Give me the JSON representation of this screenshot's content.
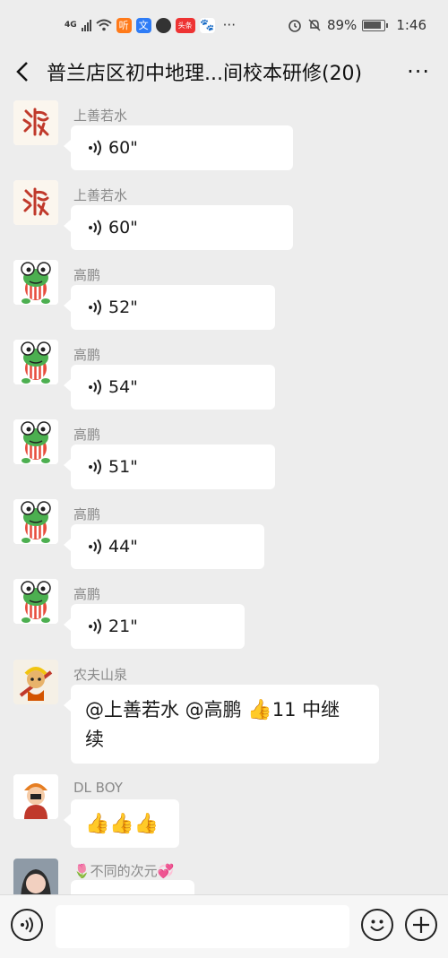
{
  "status_bar": {
    "network": "4G",
    "battery": "89%",
    "time": "1:46",
    "app_badges": [
      "听",
      "文",
      "头条"
    ],
    "overflow": "···"
  },
  "header": {
    "title": "普兰店区初中地理...间校本研修(20)",
    "more": "···"
  },
  "messages": [
    {
      "sender": "上善若水",
      "duration": "60\""
    },
    {
      "sender": "上善若水",
      "duration": "60\""
    },
    {
      "sender": "高鹏",
      "duration": "52\""
    },
    {
      "sender": "高鹏",
      "duration": "54\""
    },
    {
      "sender": "高鹏",
      "duration": "51\""
    },
    {
      "sender": "高鹏",
      "duration": "44\""
    },
    {
      "sender": "高鹏",
      "duration": "21\""
    },
    {
      "sender": "农夫山泉",
      "text_line1_a": "@上善若水  @高鹏  ",
      "text_line1_b": "11 中继",
      "text_line2": "续"
    },
    {
      "sender": "DL BOY",
      "thumbs": "👍👍👍"
    },
    {
      "sender": "🌷不同的次元💞"
    }
  ],
  "emoji": {
    "thumbs_up": "👍"
  },
  "input": {
    "value": ""
  },
  "icons": {
    "back": "chevron-left-icon",
    "voice": "voice-icon",
    "emoji": "smiley-icon",
    "plus": "plus-icon",
    "alarm": "alarm-icon",
    "mute": "bell-off-icon"
  },
  "colors": {
    "background": "#ededed",
    "bubble": "#ffffff",
    "sender_text": "#8a8a8a",
    "frog_green": "#4caf50"
  }
}
